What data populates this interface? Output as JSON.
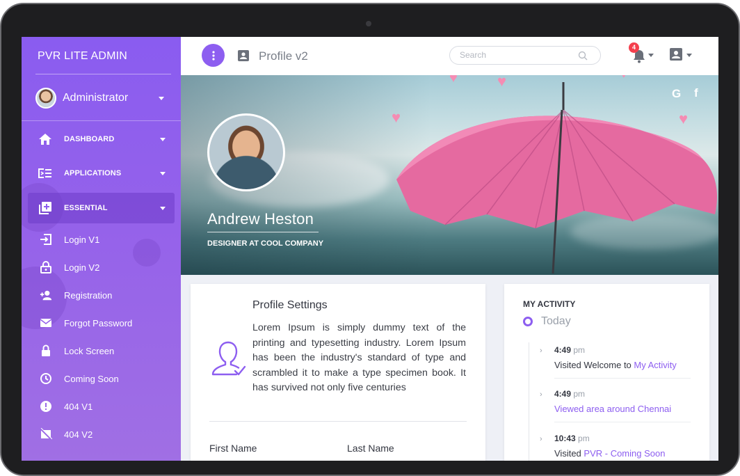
{
  "brand": "PVR  LITE ADMIN",
  "sidebar": {
    "user_name": "Administrator",
    "items": [
      {
        "label": "DASHBOARD"
      },
      {
        "label": "APPLICATIONS"
      },
      {
        "label": "ESSENTIAL"
      }
    ],
    "sub_items": [
      {
        "label": "Login V1",
        "icon": "login-icon"
      },
      {
        "label": "Login V2",
        "icon": "lock-open-icon"
      },
      {
        "label": "Registration",
        "icon": "user-add-icon"
      },
      {
        "label": "Forgot Password",
        "icon": "mail-icon"
      },
      {
        "label": "Lock Screen",
        "icon": "lock-icon"
      },
      {
        "label": "Coming Soon",
        "icon": "timer-icon"
      },
      {
        "label": "404 V1",
        "icon": "alert-icon"
      },
      {
        "label": "404 V2",
        "icon": "image-off-icon"
      }
    ]
  },
  "topbar": {
    "page_title": "Profile v2",
    "search_placeholder": "Search",
    "notification_count": "4"
  },
  "profile": {
    "name": "Andrew Heston",
    "role": "DESIGNER AT COOL COMPANY",
    "social": {
      "google": "G",
      "facebook": "f"
    }
  },
  "settings": {
    "title": "Profile Settings",
    "text": "Lorem Ipsum is simply dummy text of the printing and typesetting industry. Lorem Ipsum has been the industry's standard of type and scrambled it to make a type specimen book. It has survived not only five centuries",
    "first_name_label": "First Name",
    "last_name_label": "Last Name"
  },
  "activity": {
    "title": "MY ACTIVITY",
    "today": "Today",
    "entries": [
      {
        "time": "4:49",
        "ampm": "pm",
        "text": "Visited Welcome to ",
        "link": "My Activity"
      },
      {
        "time": "4:49",
        "ampm": "pm",
        "text": "",
        "link": "Viewed area around Chennai"
      },
      {
        "time": "10:43",
        "ampm": "pm",
        "text": "Visited ",
        "link": "PVR - Coming Soon"
      }
    ]
  },
  "colors": {
    "accent": "#8d5ef0",
    "badge": "#f43f4d",
    "sidebar_top": "#8a5cf0",
    "sidebar_bottom": "#a06fe4"
  }
}
